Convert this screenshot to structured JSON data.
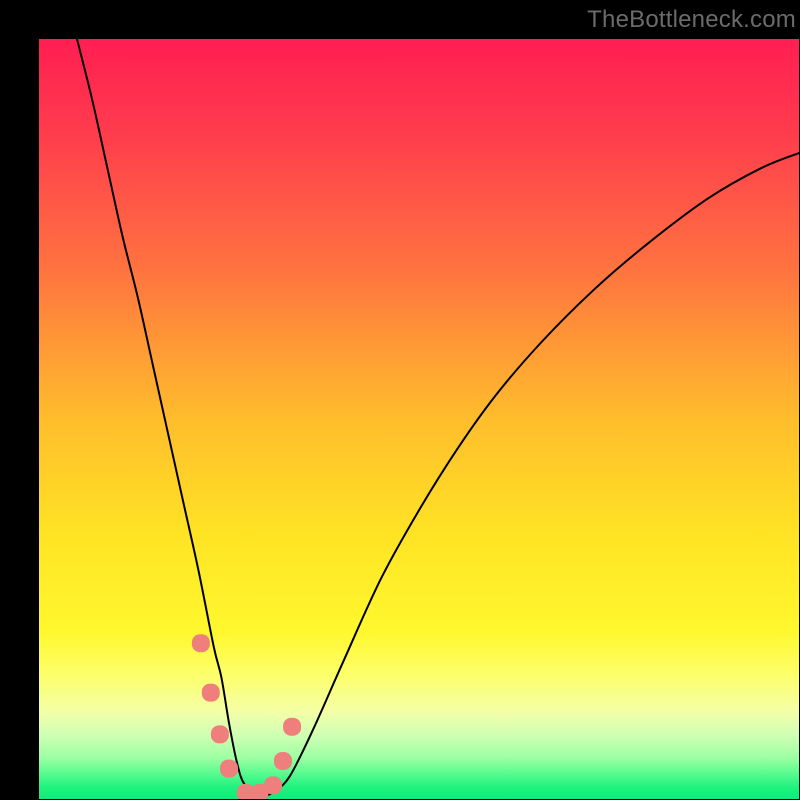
{
  "watermark": "TheBottleneck.com",
  "chart_data": {
    "type": "line",
    "title": "",
    "xlabel": "",
    "ylabel": "",
    "xlim": [
      0,
      100
    ],
    "ylim": [
      0,
      100
    ],
    "grid": false,
    "legend": false,
    "background_gradient": {
      "stops": [
        {
          "pos": 0.0,
          "color": "#ff1e52"
        },
        {
          "pos": 0.12,
          "color": "#ff3b4d"
        },
        {
          "pos": 0.3,
          "color": "#ff7240"
        },
        {
          "pos": 0.5,
          "color": "#ffbd2c"
        },
        {
          "pos": 0.65,
          "color": "#ffe324"
        },
        {
          "pos": 0.78,
          "color": "#fff82e"
        },
        {
          "pos": 0.84,
          "color": "#fcff6e"
        },
        {
          "pos": 0.885,
          "color": "#f4ffa7"
        },
        {
          "pos": 0.915,
          "color": "#d0ffb4"
        },
        {
          "pos": 0.945,
          "color": "#9fffa3"
        },
        {
          "pos": 0.965,
          "color": "#5dfc91"
        },
        {
          "pos": 0.985,
          "color": "#1ef27e"
        },
        {
          "pos": 1.0,
          "color": "#12ea79"
        }
      ]
    },
    "series": [
      {
        "name": "bottleneck-curve",
        "color": "#000000",
        "stroke_width": 2,
        "x": [
          5,
          7,
          9,
          11,
          13,
          15,
          17,
          19,
          21,
          23,
          24,
          25,
          26,
          27,
          29,
          30,
          31,
          33,
          36,
          40,
          45,
          50,
          55,
          60,
          66,
          73,
          80,
          88,
          95,
          100
        ],
        "y": [
          100,
          92,
          83,
          74,
          66,
          57,
          48,
          39,
          30,
          20,
          16,
          10,
          5,
          2,
          0.5,
          0.5,
          1,
          3,
          9,
          18,
          29,
          38,
          46,
          53,
          60,
          67,
          73,
          79,
          83,
          85
        ]
      },
      {
        "name": "salmon-markers",
        "type": "scatter",
        "color": "#ef7f7c",
        "marker": "rounded-rect",
        "size": 18,
        "x": [
          21.3,
          22.6,
          23.8,
          25.0,
          27.2,
          29.0,
          30.8,
          32.1,
          33.3
        ],
        "y": [
          20.5,
          14.0,
          8.5,
          4.0,
          0.8,
          0.8,
          1.8,
          5.0,
          9.5
        ]
      }
    ]
  }
}
